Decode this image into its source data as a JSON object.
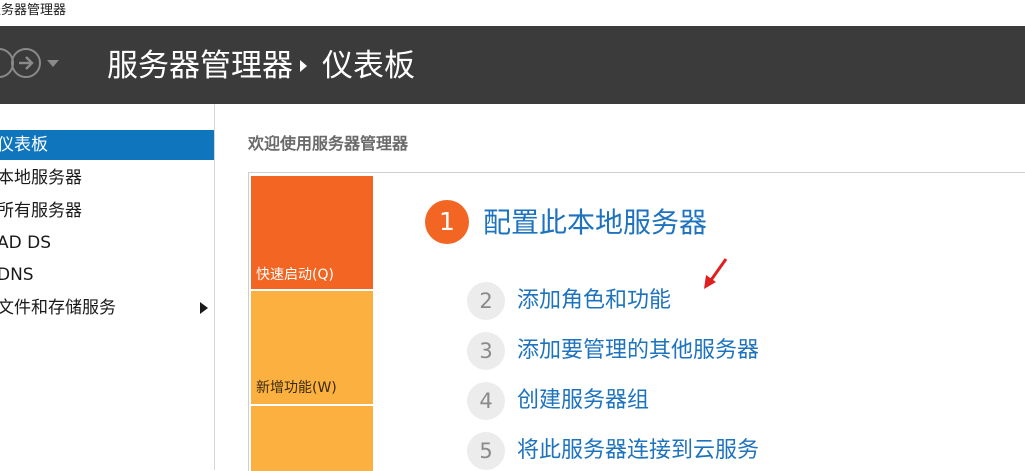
{
  "window": {
    "title": "服务器管理器"
  },
  "header": {
    "breadcrumb_root": "服务器管理器",
    "breadcrumb_current": "仪表板"
  },
  "sidebar": {
    "items": [
      {
        "label": "仪表板",
        "selected": true
      },
      {
        "label": "本地服务器",
        "selected": false
      },
      {
        "label": "所有服务器",
        "selected": false
      },
      {
        "label": "AD DS",
        "selected": false
      },
      {
        "label": "DNS",
        "selected": false
      },
      {
        "label": "文件和存储服务",
        "selected": false,
        "expandable": true
      }
    ]
  },
  "main": {
    "welcome_title": "欢迎使用服务器管理器",
    "tiles": [
      {
        "label": "快速启动(Q)",
        "color": "#f26522"
      },
      {
        "label": "新增功能(W)",
        "color": "#fbb040"
      },
      {
        "label": "",
        "color": "#fbb040"
      }
    ],
    "steps": [
      {
        "number": "1",
        "label": "配置此本地服务器"
      },
      {
        "number": "2",
        "label": "添加角色和功能"
      },
      {
        "number": "3",
        "label": "添加要管理的其他服务器"
      },
      {
        "number": "4",
        "label": "创建服务器组"
      },
      {
        "number": "5",
        "label": "将此服务器连接到云服务"
      }
    ]
  },
  "colors": {
    "header_bg": "#3b3b3b",
    "selected_bg": "#0f75bc",
    "link": "#1e73be",
    "step_accent": "#f26522",
    "annotation": "#e02020"
  }
}
